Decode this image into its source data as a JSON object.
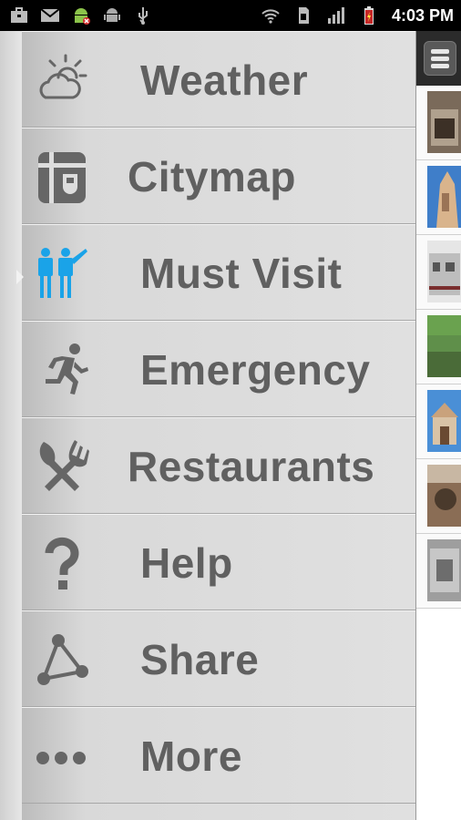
{
  "status_bar": {
    "time": "4:03 PM",
    "left_icons": [
      "briefcase-icon",
      "gmail-icon",
      "android-debug-icon",
      "android-icon",
      "usb-icon"
    ],
    "right_icons": [
      "wifi-icon",
      "sim-icon",
      "signal-icon",
      "battery-icon"
    ]
  },
  "menu": {
    "items": [
      {
        "label": "Weather",
        "icon": "weather-icon"
      },
      {
        "label": "Citymap",
        "icon": "citymap-icon"
      },
      {
        "label": "Must Visit",
        "icon": "must-visit-icon",
        "selected": true,
        "accent": "#1aa3e8"
      },
      {
        "label": "Emergency",
        "icon": "emergency-icon"
      },
      {
        "label": "Restaurants",
        "icon": "restaurants-icon"
      },
      {
        "label": "Help",
        "icon": "help-icon"
      },
      {
        "label": "Share",
        "icon": "share-icon"
      },
      {
        "label": "More",
        "icon": "more-icon"
      }
    ]
  },
  "content": {
    "menu_button_icon": "hamburger-icon",
    "thumbnails": 7
  },
  "colors": {
    "label_gray": "#606060",
    "accent_blue": "#1aa3e8",
    "status_bar_bg": "#000000"
  }
}
